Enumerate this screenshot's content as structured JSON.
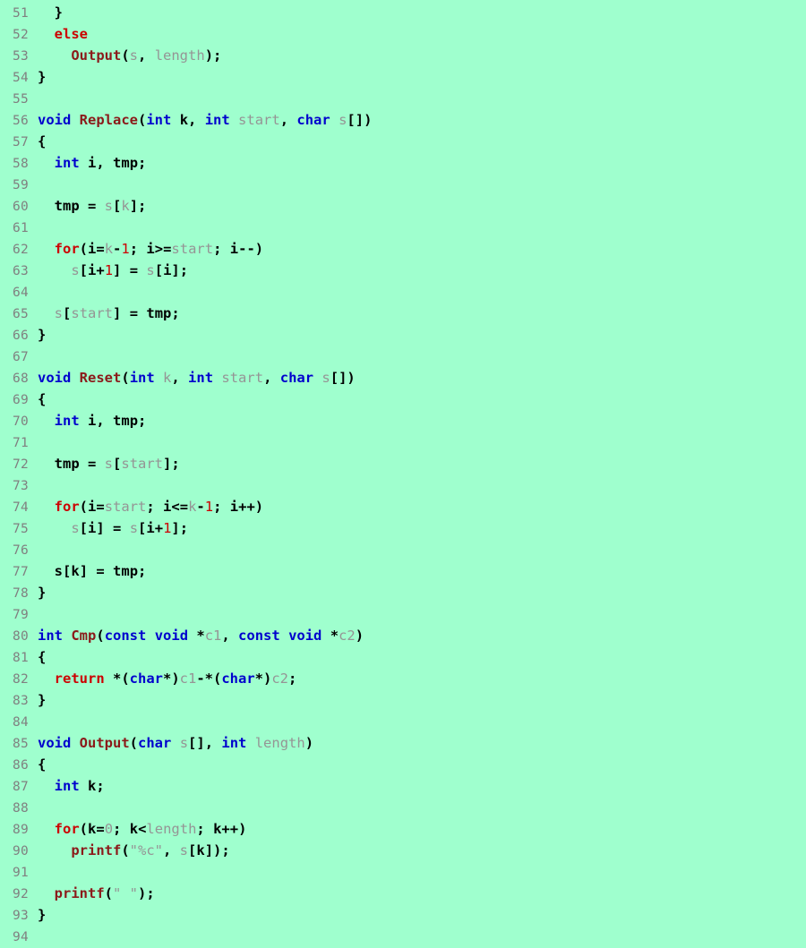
{
  "editor": {
    "background_color": "#9FFFCE",
    "line_number_color": "#808080",
    "language": "c",
    "first_line_number": 51,
    "last_line_number": 94
  },
  "palette": {
    "keyword": "#0000CD",
    "control": "#CC0000",
    "function": "#8B1A1A",
    "identifier_gray": "#959595",
    "identifier_black": "#000000",
    "number": "#CC0000",
    "string": "#959595",
    "punctuation": "#000000"
  },
  "lines": [
    {
      "n": "51",
      "tokens": [
        {
          "t": "  ",
          "c": "pun"
        },
        {
          "t": "}",
          "c": "pun"
        }
      ]
    },
    {
      "n": "52",
      "tokens": [
        {
          "t": "  ",
          "c": "pun"
        },
        {
          "t": "else",
          "c": "ctl"
        }
      ]
    },
    {
      "n": "53",
      "tokens": [
        {
          "t": "    ",
          "c": "pun"
        },
        {
          "t": "Output",
          "c": "fn"
        },
        {
          "t": "(",
          "c": "pun"
        },
        {
          "t": "s",
          "c": "gray"
        },
        {
          "t": ", ",
          "c": "pun"
        },
        {
          "t": "length",
          "c": "gray"
        },
        {
          "t": ")",
          "c": "pun"
        },
        {
          "t": ";",
          "c": "pun"
        }
      ]
    },
    {
      "n": "54",
      "tokens": [
        {
          "t": "}",
          "c": "pun"
        }
      ]
    },
    {
      "n": "55",
      "tokens": []
    },
    {
      "n": "56",
      "tokens": [
        {
          "t": "void",
          "c": "kw"
        },
        {
          "t": " ",
          "c": "pun"
        },
        {
          "t": "Replace",
          "c": "fn"
        },
        {
          "t": "(",
          "c": "pun"
        },
        {
          "t": "int",
          "c": "kw"
        },
        {
          "t": " ",
          "c": "pun"
        },
        {
          "t": "k",
          "c": "id"
        },
        {
          "t": ", ",
          "c": "pun"
        },
        {
          "t": "int",
          "c": "kw"
        },
        {
          "t": " ",
          "c": "pun"
        },
        {
          "t": "start",
          "c": "gray"
        },
        {
          "t": ", ",
          "c": "pun"
        },
        {
          "t": "char",
          "c": "kw"
        },
        {
          "t": " ",
          "c": "pun"
        },
        {
          "t": "s",
          "c": "gray"
        },
        {
          "t": "[])",
          "c": "pun"
        }
      ]
    },
    {
      "n": "57",
      "tokens": [
        {
          "t": "{",
          "c": "pun"
        }
      ]
    },
    {
      "n": "58",
      "tokens": [
        {
          "t": "  ",
          "c": "pun"
        },
        {
          "t": "int",
          "c": "kw"
        },
        {
          "t": " ",
          "c": "pun"
        },
        {
          "t": "i",
          "c": "id"
        },
        {
          "t": ", ",
          "c": "pun"
        },
        {
          "t": "tmp",
          "c": "id"
        },
        {
          "t": ";",
          "c": "pun"
        }
      ]
    },
    {
      "n": "59",
      "tokens": []
    },
    {
      "n": "60",
      "tokens": [
        {
          "t": "  ",
          "c": "pun"
        },
        {
          "t": "tmp",
          "c": "id"
        },
        {
          "t": " = ",
          "c": "pun"
        },
        {
          "t": "s",
          "c": "gray"
        },
        {
          "t": "[",
          "c": "pun"
        },
        {
          "t": "k",
          "c": "gray"
        },
        {
          "t": "]",
          "c": "pun"
        },
        {
          "t": ";",
          "c": "pun"
        }
      ]
    },
    {
      "n": "61",
      "tokens": []
    },
    {
      "n": "62",
      "tokens": [
        {
          "t": "  ",
          "c": "pun"
        },
        {
          "t": "for",
          "c": "ctl"
        },
        {
          "t": "(",
          "c": "pun"
        },
        {
          "t": "i",
          "c": "id"
        },
        {
          "t": "=",
          "c": "pun"
        },
        {
          "t": "k",
          "c": "gray"
        },
        {
          "t": "-",
          "c": "pun"
        },
        {
          "t": "1",
          "c": "num"
        },
        {
          "t": "; ",
          "c": "pun"
        },
        {
          "t": "i",
          "c": "id"
        },
        {
          "t": ">=",
          "c": "pun"
        },
        {
          "t": "start",
          "c": "gray"
        },
        {
          "t": "; ",
          "c": "pun"
        },
        {
          "t": "i",
          "c": "id"
        },
        {
          "t": "--)",
          "c": "pun"
        }
      ]
    },
    {
      "n": "63",
      "tokens": [
        {
          "t": "    ",
          "c": "pun"
        },
        {
          "t": "s",
          "c": "gray"
        },
        {
          "t": "[",
          "c": "pun"
        },
        {
          "t": "i",
          "c": "id"
        },
        {
          "t": "+",
          "c": "pun"
        },
        {
          "t": "1",
          "c": "num"
        },
        {
          "t": "] = ",
          "c": "pun"
        },
        {
          "t": "s",
          "c": "gray"
        },
        {
          "t": "[",
          "c": "pun"
        },
        {
          "t": "i",
          "c": "id"
        },
        {
          "t": "]",
          "c": "pun"
        },
        {
          "t": ";",
          "c": "pun"
        }
      ]
    },
    {
      "n": "64",
      "tokens": []
    },
    {
      "n": "65",
      "tokens": [
        {
          "t": "  ",
          "c": "pun"
        },
        {
          "t": "s",
          "c": "gray"
        },
        {
          "t": "[",
          "c": "pun"
        },
        {
          "t": "start",
          "c": "gray"
        },
        {
          "t": "] = ",
          "c": "pun"
        },
        {
          "t": "tmp",
          "c": "id"
        },
        {
          "t": ";",
          "c": "pun"
        }
      ]
    },
    {
      "n": "66",
      "tokens": [
        {
          "t": "}",
          "c": "pun"
        }
      ]
    },
    {
      "n": "67",
      "tokens": []
    },
    {
      "n": "68",
      "tokens": [
        {
          "t": "void",
          "c": "kw"
        },
        {
          "t": " ",
          "c": "pun"
        },
        {
          "t": "Reset",
          "c": "fn"
        },
        {
          "t": "(",
          "c": "pun"
        },
        {
          "t": "int",
          "c": "kw"
        },
        {
          "t": " ",
          "c": "pun"
        },
        {
          "t": "k",
          "c": "gray"
        },
        {
          "t": ", ",
          "c": "pun"
        },
        {
          "t": "int",
          "c": "kw"
        },
        {
          "t": " ",
          "c": "pun"
        },
        {
          "t": "start",
          "c": "gray"
        },
        {
          "t": ", ",
          "c": "pun"
        },
        {
          "t": "char",
          "c": "kw"
        },
        {
          "t": " ",
          "c": "pun"
        },
        {
          "t": "s",
          "c": "gray"
        },
        {
          "t": "[])",
          "c": "pun"
        }
      ]
    },
    {
      "n": "69",
      "tokens": [
        {
          "t": "{",
          "c": "pun"
        }
      ]
    },
    {
      "n": "70",
      "tokens": [
        {
          "t": "  ",
          "c": "pun"
        },
        {
          "t": "int",
          "c": "kw"
        },
        {
          "t": " ",
          "c": "pun"
        },
        {
          "t": "i",
          "c": "id"
        },
        {
          "t": ", ",
          "c": "pun"
        },
        {
          "t": "tmp",
          "c": "id"
        },
        {
          "t": ";",
          "c": "pun"
        }
      ]
    },
    {
      "n": "71",
      "tokens": []
    },
    {
      "n": "72",
      "tokens": [
        {
          "t": "  ",
          "c": "pun"
        },
        {
          "t": "tmp",
          "c": "id"
        },
        {
          "t": " = ",
          "c": "pun"
        },
        {
          "t": "s",
          "c": "gray"
        },
        {
          "t": "[",
          "c": "pun"
        },
        {
          "t": "start",
          "c": "gray"
        },
        {
          "t": "]",
          "c": "pun"
        },
        {
          "t": ";",
          "c": "pun"
        }
      ]
    },
    {
      "n": "73",
      "tokens": []
    },
    {
      "n": "74",
      "tokens": [
        {
          "t": "  ",
          "c": "pun"
        },
        {
          "t": "for",
          "c": "ctl"
        },
        {
          "t": "(",
          "c": "pun"
        },
        {
          "t": "i",
          "c": "id"
        },
        {
          "t": "=",
          "c": "pun"
        },
        {
          "t": "start",
          "c": "gray"
        },
        {
          "t": "; ",
          "c": "pun"
        },
        {
          "t": "i",
          "c": "id"
        },
        {
          "t": "<=",
          "c": "pun"
        },
        {
          "t": "k",
          "c": "gray"
        },
        {
          "t": "-",
          "c": "pun"
        },
        {
          "t": "1",
          "c": "num"
        },
        {
          "t": "; ",
          "c": "pun"
        },
        {
          "t": "i",
          "c": "id"
        },
        {
          "t": "++)",
          "c": "pun"
        }
      ]
    },
    {
      "n": "75",
      "tokens": [
        {
          "t": "    ",
          "c": "pun"
        },
        {
          "t": "s",
          "c": "gray"
        },
        {
          "t": "[",
          "c": "pun"
        },
        {
          "t": "i",
          "c": "id"
        },
        {
          "t": "] = ",
          "c": "pun"
        },
        {
          "t": "s",
          "c": "gray"
        },
        {
          "t": "[",
          "c": "pun"
        },
        {
          "t": "i",
          "c": "id"
        },
        {
          "t": "+",
          "c": "pun"
        },
        {
          "t": "1",
          "c": "num"
        },
        {
          "t": "]",
          "c": "pun"
        },
        {
          "t": ";",
          "c": "pun"
        }
      ]
    },
    {
      "n": "76",
      "tokens": []
    },
    {
      "n": "77",
      "tokens": [
        {
          "t": "  ",
          "c": "pun"
        },
        {
          "t": "s",
          "c": "id"
        },
        {
          "t": "[",
          "c": "pun"
        },
        {
          "t": "k",
          "c": "id"
        },
        {
          "t": "] = ",
          "c": "pun"
        },
        {
          "t": "tmp",
          "c": "id"
        },
        {
          "t": ";",
          "c": "pun"
        }
      ]
    },
    {
      "n": "78",
      "tokens": [
        {
          "t": "}",
          "c": "pun"
        }
      ]
    },
    {
      "n": "79",
      "tokens": []
    },
    {
      "n": "80",
      "tokens": [
        {
          "t": "int",
          "c": "kw"
        },
        {
          "t": " ",
          "c": "pun"
        },
        {
          "t": "Cmp",
          "c": "fn"
        },
        {
          "t": "(",
          "c": "pun"
        },
        {
          "t": "const",
          "c": "kw"
        },
        {
          "t": " ",
          "c": "pun"
        },
        {
          "t": "void",
          "c": "kw"
        },
        {
          "t": " *",
          "c": "pun"
        },
        {
          "t": "c1",
          "c": "gray"
        },
        {
          "t": ", ",
          "c": "pun"
        },
        {
          "t": "const",
          "c": "kw"
        },
        {
          "t": " ",
          "c": "pun"
        },
        {
          "t": "void",
          "c": "kw"
        },
        {
          "t": " *",
          "c": "pun"
        },
        {
          "t": "c2",
          "c": "gray"
        },
        {
          "t": ")",
          "c": "pun"
        }
      ]
    },
    {
      "n": "81",
      "tokens": [
        {
          "t": "{",
          "c": "pun"
        }
      ]
    },
    {
      "n": "82",
      "tokens": [
        {
          "t": "  ",
          "c": "pun"
        },
        {
          "t": "return",
          "c": "ctl"
        },
        {
          "t": " *(",
          "c": "pun"
        },
        {
          "t": "char",
          "c": "kw"
        },
        {
          "t": "*)",
          "c": "pun"
        },
        {
          "t": "c1",
          "c": "gray"
        },
        {
          "t": "-*(",
          "c": "pun"
        },
        {
          "t": "char",
          "c": "kw"
        },
        {
          "t": "*)",
          "c": "pun"
        },
        {
          "t": "c2",
          "c": "gray"
        },
        {
          "t": ";",
          "c": "pun"
        }
      ]
    },
    {
      "n": "83",
      "tokens": [
        {
          "t": "}",
          "c": "pun"
        }
      ]
    },
    {
      "n": "84",
      "tokens": []
    },
    {
      "n": "85",
      "tokens": [
        {
          "t": "void",
          "c": "kw"
        },
        {
          "t": " ",
          "c": "pun"
        },
        {
          "t": "Output",
          "c": "fn"
        },
        {
          "t": "(",
          "c": "pun"
        },
        {
          "t": "char",
          "c": "kw"
        },
        {
          "t": " ",
          "c": "pun"
        },
        {
          "t": "s",
          "c": "gray"
        },
        {
          "t": "[], ",
          "c": "pun"
        },
        {
          "t": "int",
          "c": "kw"
        },
        {
          "t": " ",
          "c": "pun"
        },
        {
          "t": "length",
          "c": "gray"
        },
        {
          "t": ")",
          "c": "pun"
        }
      ]
    },
    {
      "n": "86",
      "tokens": [
        {
          "t": "{",
          "c": "pun"
        }
      ]
    },
    {
      "n": "87",
      "tokens": [
        {
          "t": "  ",
          "c": "pun"
        },
        {
          "t": "int",
          "c": "kw"
        },
        {
          "t": " ",
          "c": "pun"
        },
        {
          "t": "k",
          "c": "id"
        },
        {
          "t": ";",
          "c": "pun"
        }
      ]
    },
    {
      "n": "88",
      "tokens": []
    },
    {
      "n": "89",
      "tokens": [
        {
          "t": "  ",
          "c": "pun"
        },
        {
          "t": "for",
          "c": "ctl"
        },
        {
          "t": "(",
          "c": "pun"
        },
        {
          "t": "k",
          "c": "id"
        },
        {
          "t": "=",
          "c": "pun"
        },
        {
          "t": "0",
          "c": "gray"
        },
        {
          "t": "; ",
          "c": "pun"
        },
        {
          "t": "k",
          "c": "id"
        },
        {
          "t": "<",
          "c": "pun"
        },
        {
          "t": "length",
          "c": "gray"
        },
        {
          "t": "; ",
          "c": "pun"
        },
        {
          "t": "k",
          "c": "id"
        },
        {
          "t": "++)",
          "c": "pun"
        }
      ]
    },
    {
      "n": "90",
      "tokens": [
        {
          "t": "    ",
          "c": "pun"
        },
        {
          "t": "printf",
          "c": "fn"
        },
        {
          "t": "(",
          "c": "pun"
        },
        {
          "t": "\"%c\"",
          "c": "str"
        },
        {
          "t": ", ",
          "c": "pun"
        },
        {
          "t": "s",
          "c": "gray"
        },
        {
          "t": "[",
          "c": "pun"
        },
        {
          "t": "k",
          "c": "id"
        },
        {
          "t": "])",
          "c": "pun"
        },
        {
          "t": ";",
          "c": "pun"
        }
      ]
    },
    {
      "n": "91",
      "tokens": []
    },
    {
      "n": "92",
      "tokens": [
        {
          "t": "  ",
          "c": "pun"
        },
        {
          "t": "printf",
          "c": "fn"
        },
        {
          "t": "(",
          "c": "pun"
        },
        {
          "t": "\" \"",
          "c": "str"
        },
        {
          "t": ")",
          "c": "pun"
        },
        {
          "t": ";",
          "c": "pun"
        }
      ]
    },
    {
      "n": "93",
      "tokens": [
        {
          "t": "}",
          "c": "pun"
        }
      ]
    },
    {
      "n": "94",
      "tokens": []
    }
  ]
}
